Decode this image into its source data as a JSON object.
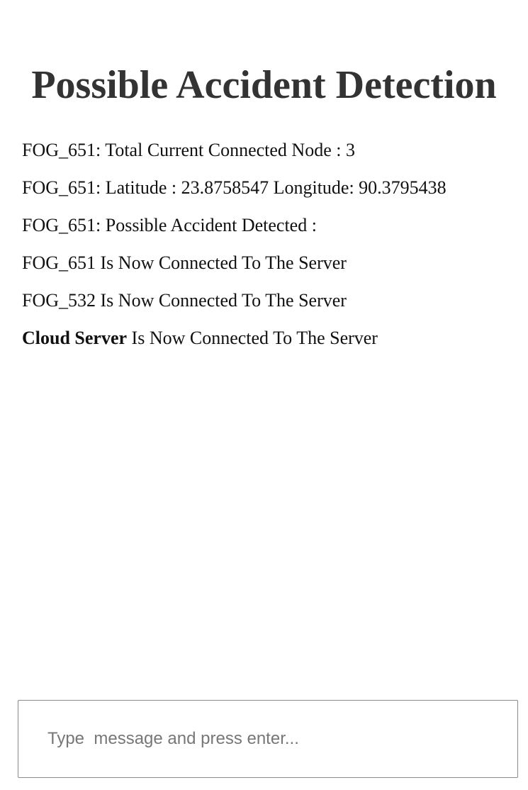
{
  "page": {
    "title": "Possible Accident Detection"
  },
  "messages": [
    {
      "sender": "",
      "text": "FOG_651: Total Current Connected Node : 3"
    },
    {
      "sender": "",
      "text": "FOG_651: Latitude : 23.8758547 Longitude: 90.3795438"
    },
    {
      "sender": "",
      "text": "FOG_651: Possible Accident Detected :"
    },
    {
      "sender": "",
      "text": "FOG_651 Is Now Connected To The Server"
    },
    {
      "sender": "",
      "text": "FOG_532 Is Now Connected To The Server"
    },
    {
      "sender": "Cloud Server",
      "text": " Is Now Connected To The Server"
    }
  ],
  "composer": {
    "placeholder": "Type  message and press enter...",
    "value": ""
  }
}
